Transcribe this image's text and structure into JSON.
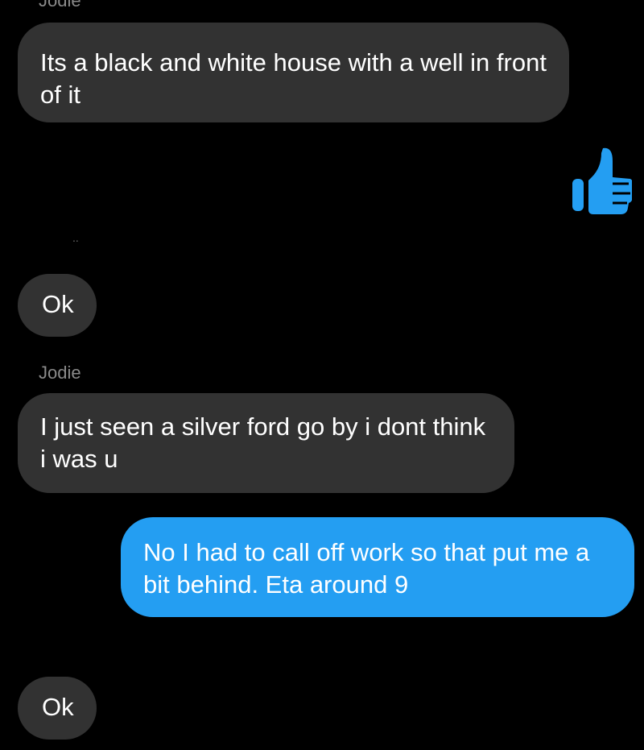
{
  "colors": {
    "background": "#000000",
    "incoming_bubble": "#323232",
    "outgoing_bubble": "#249ef2",
    "text": "#ffffff",
    "like_icon": "#249ef2"
  },
  "messages": [
    {
      "sender": "Jodie",
      "text": "Its a black and white house with a well in front of it"
    },
    {
      "text": "Ok"
    },
    {
      "sender": "Jodie",
      "text": "I just seen a silver ford go by i dont think i was u"
    },
    {
      "text": "No I had to call off work so that put me a bit behind. Eta around 9"
    },
    {
      "text": "Ok"
    }
  ],
  "reaction": {
    "icon": "thumbs-up-icon"
  }
}
